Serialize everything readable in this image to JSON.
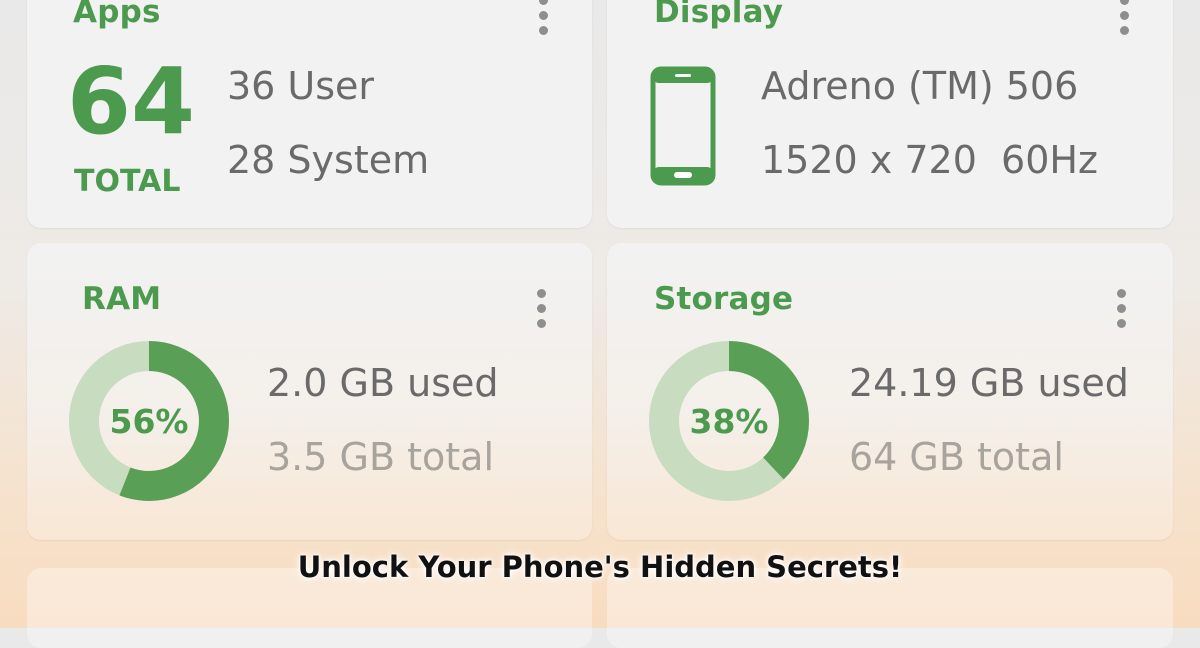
{
  "apps": {
    "title": "Apps",
    "total_value": "64",
    "total_label": "TOTAL",
    "user": "36 User",
    "system": "28 System"
  },
  "display": {
    "title": "Display",
    "gpu": "Adreno (TM) 506",
    "resolution": "1520 x 720  60Hz"
  },
  "ram": {
    "title": "RAM",
    "percent_label": "56%",
    "percent": 56,
    "used": "2.0 GB used",
    "total": "3.5 GB total"
  },
  "storage": {
    "title": "Storage",
    "percent_label": "38%",
    "percent": 38,
    "used": "24.19 GB used",
    "total": "64 GB total"
  },
  "caption": "Unlock Your Phone's Hidden Secrets!",
  "colors": {
    "accent": "#4c9a4e",
    "accent_light": "#c8dcbf"
  },
  "icons": {
    "menu": "more-vert-icon",
    "phone": "smartphone-icon"
  }
}
